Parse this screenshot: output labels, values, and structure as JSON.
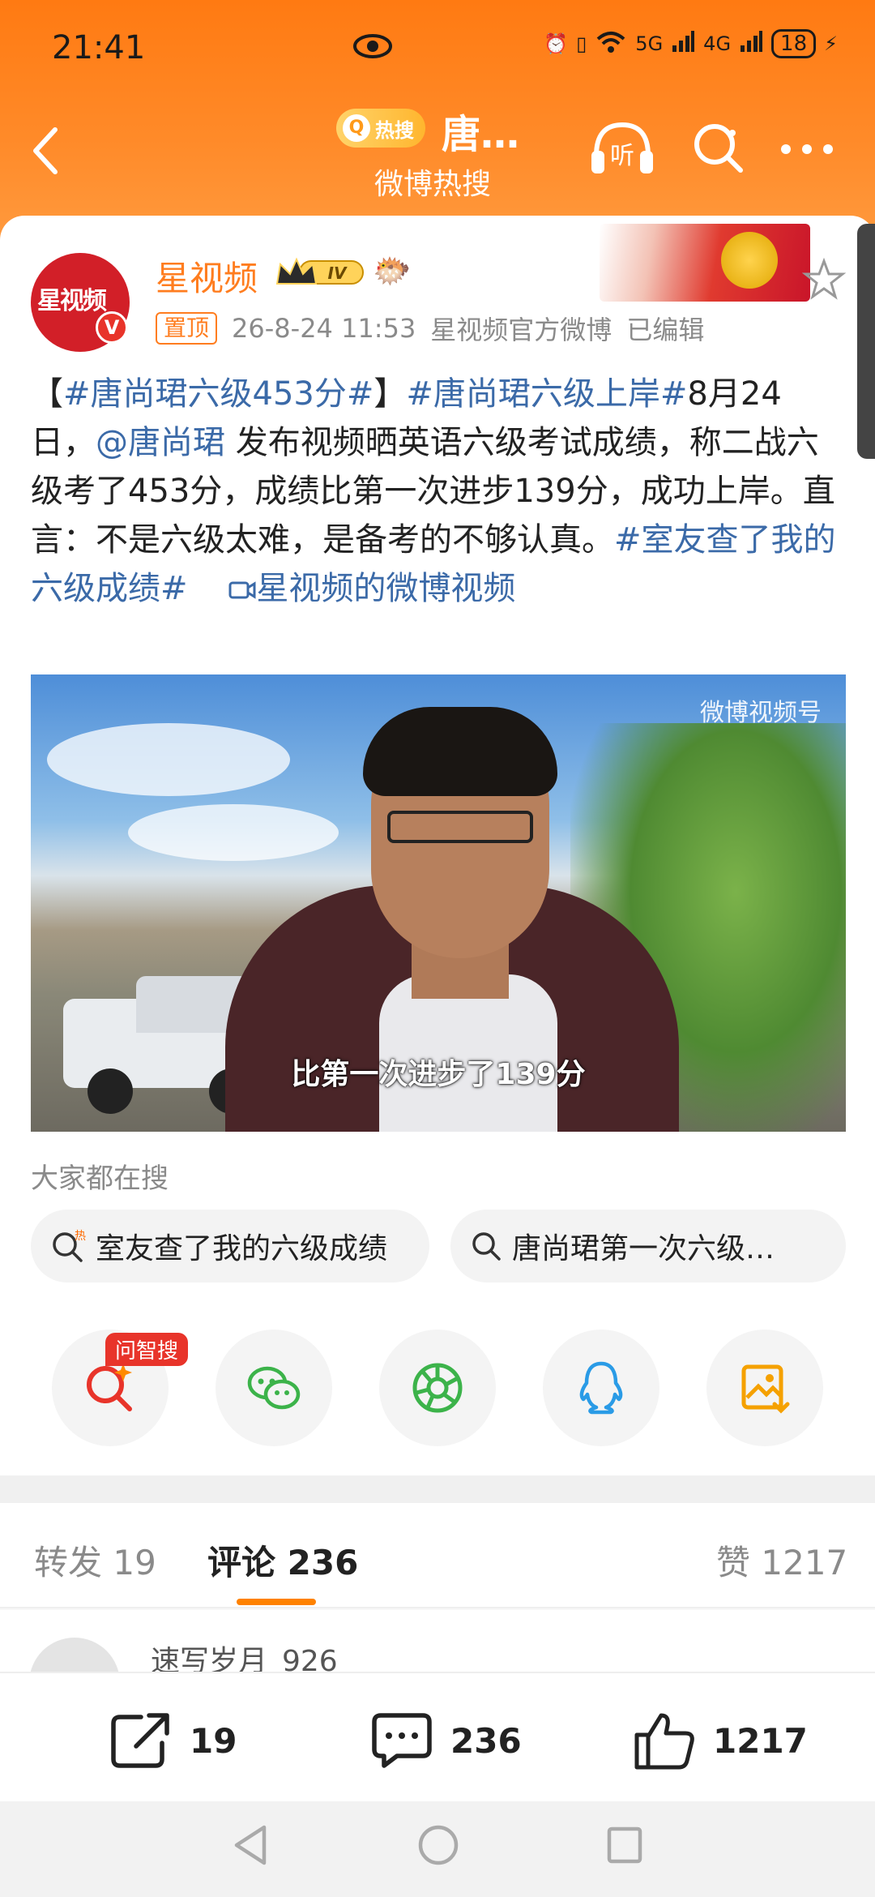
{
  "status_bar": {
    "time": "21:41",
    "battery": "18",
    "signal1": "5G",
    "signal2": "4G"
  },
  "nav": {
    "hot_badge": "热搜",
    "title": "唐…",
    "subtitle": "微博热搜",
    "listen_label": "听"
  },
  "author": {
    "avatar_text": "星视频",
    "verified_mark": "V",
    "name": "星视频",
    "level": "IV",
    "pin_label": "置顶",
    "date": "26-8-24 11:53",
    "source": "星视频官方微博",
    "edited": "已编辑"
  },
  "post": {
    "segments": [
      {
        "text": "【",
        "type": "text"
      },
      {
        "text": "#唐尚珺六级453分#",
        "type": "tag"
      },
      {
        "text": "】",
        "type": "text"
      },
      {
        "text": "#唐尚珺六级上岸#",
        "type": "tag"
      },
      {
        "text": "8月24日，",
        "type": "text"
      },
      {
        "text": "@唐尚珺",
        "type": "tag"
      },
      {
        "text": " 发布视频晒英语六级考试成绩，称二战六级考了453分，成绩比第一次进步139分，成功上岸。直言：不是六级太难，是备考的不够认真。",
        "type": "text"
      },
      {
        "text": "#室友查了我的六级成绩#",
        "type": "tag"
      },
      {
        "text": "    ",
        "type": "text"
      },
      {
        "text": "星视频的微博视频",
        "type": "video-link"
      }
    ]
  },
  "video": {
    "watermark": "微博视频号",
    "caption": "比第一次进步了139分"
  },
  "related": {
    "heading": "大家都在搜",
    "chips": [
      {
        "badge": "热",
        "text": "室友查了我的六级成绩"
      },
      {
        "badge": "",
        "text": "唐尚珺第一次六级…"
      }
    ]
  },
  "share": {
    "ai_badge": "问智搜",
    "targets": [
      "问智搜",
      "微信",
      "朋友圈",
      "QQ",
      "保存图片"
    ]
  },
  "tabs": [
    {
      "label": "转发",
      "count": "19"
    },
    {
      "label": "评论",
      "count": "236"
    },
    {
      "label": "赞",
      "count": "1217"
    }
  ],
  "comment_preview": {
    "username": "速写岁月_926"
  },
  "bottom_bar": {
    "repost": "19",
    "comment": "236",
    "like": "1217"
  },
  "colors": {
    "accent": "#ff8200",
    "header": "#ff7a12",
    "link": "#3b6aa8",
    "name": "#ff7d1f"
  }
}
